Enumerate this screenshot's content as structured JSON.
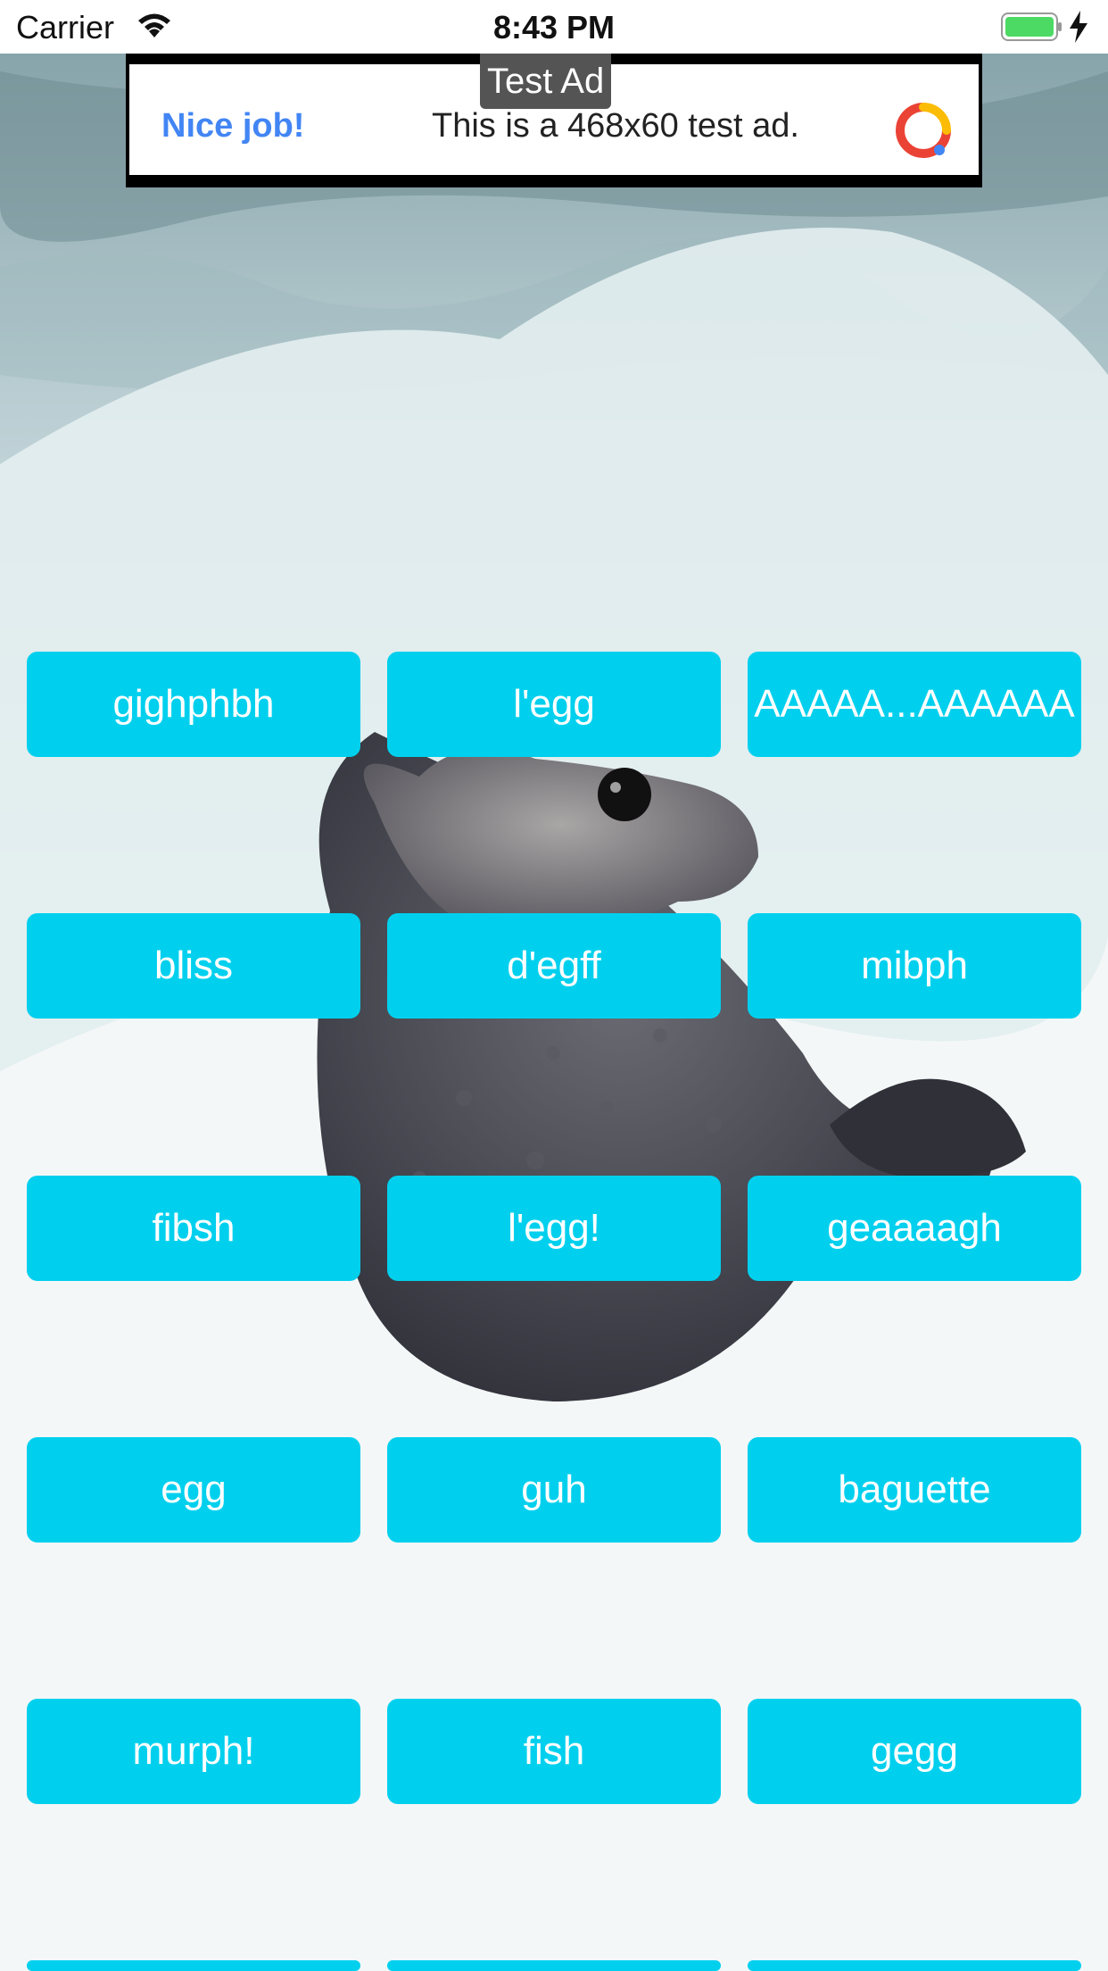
{
  "status_bar": {
    "carrier": "Carrier",
    "time": "8:43 PM",
    "wifi_icon": "wifi-icon",
    "battery_icon": "battery-icon",
    "charging_icon": "bolt-icon"
  },
  "ad": {
    "badge": "Test Ad",
    "headline": "Nice job!",
    "body": "This is a 468x60 test ad.",
    "logo_icon": "admob-logo-icon"
  },
  "colors": {
    "button_bg": "#00d0ee",
    "button_text": "#ffffff",
    "ad_headline": "#4285f4"
  },
  "buttons": [
    {
      "label": "gighphbh"
    },
    {
      "label": "l'egg"
    },
    {
      "label": "AAAAA...AAAAAA"
    },
    {
      "label": "bliss"
    },
    {
      "label": "d'egff"
    },
    {
      "label": "mibph"
    },
    {
      "label": "fibsh"
    },
    {
      "label": "l'egg!"
    },
    {
      "label": "geaaaagh"
    },
    {
      "label": "egg"
    },
    {
      "label": "guh"
    },
    {
      "label": "baguette"
    },
    {
      "label": "murph!"
    },
    {
      "label": "fish"
    },
    {
      "label": "gegg"
    },
    {
      "label": ""
    },
    {
      "label": ""
    },
    {
      "label": ""
    }
  ]
}
